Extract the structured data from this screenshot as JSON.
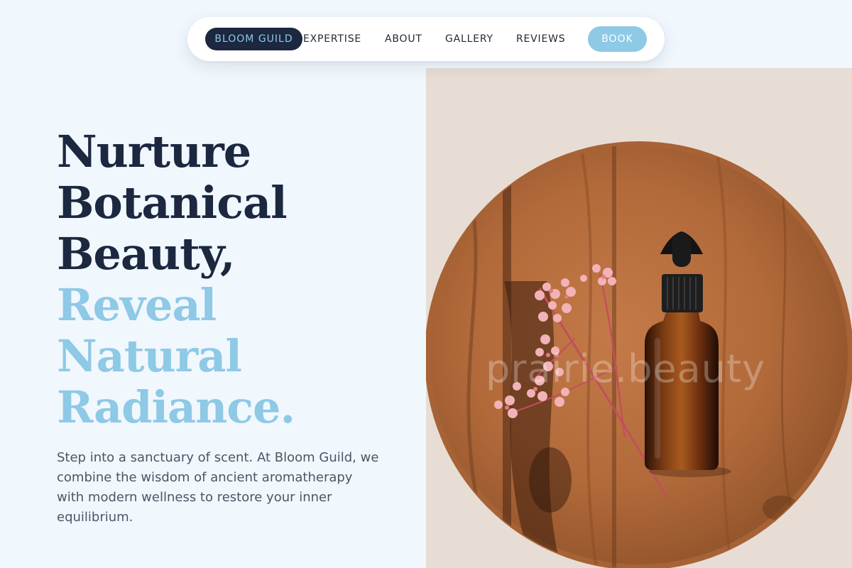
{
  "nav": {
    "brand": "BLOOM GUILD",
    "links": [
      "EXPERTISE",
      "ABOUT",
      "GALLERY",
      "REVIEWS"
    ],
    "cta": "BOOK"
  },
  "hero": {
    "headline_dark": [
      "Nurture",
      "Botanical",
      "Beauty,"
    ],
    "headline_light": [
      "Reveal",
      "Natural",
      "Radiance."
    ],
    "lede": "Step into a sanctuary of scent. At Bloom Guild, we combine the wisdom of ancient aromatherapy with modern wellness to restore your inner equilibrium.",
    "image_watermark": "prairie.beauty"
  },
  "colors": {
    "page_bg": "#f0f7fd",
    "navy": "#1c2740",
    "sky": "#8ec9e6",
    "body_text": "#4d5566"
  },
  "icons": [
    "dropper-bottle-illustration",
    "dried-flower-sprig-illustration",
    "wooden-tray-illustration"
  ]
}
